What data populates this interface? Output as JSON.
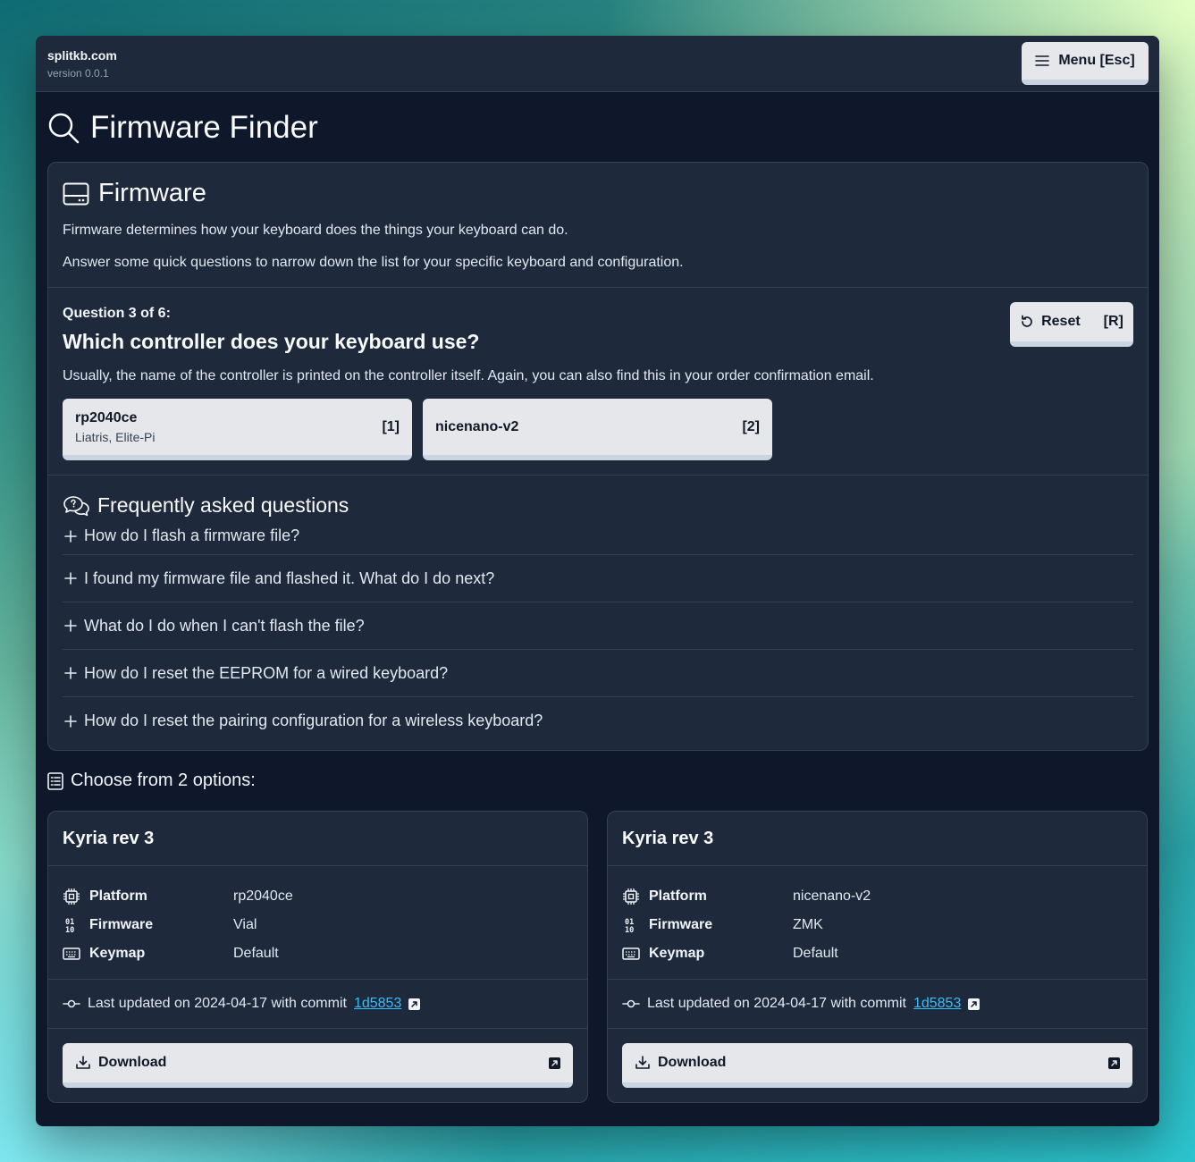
{
  "header": {
    "site": "splitkb.com",
    "version": "version 0.0.1",
    "menu_label": "Menu [Esc]"
  },
  "page": {
    "title": "Firmware Finder"
  },
  "firmware": {
    "title": "Firmware",
    "desc1": "Firmware determines how your keyboard does the things your keyboard can do.",
    "desc2": "Answer some quick questions to narrow down the list for your specific keyboard and configuration."
  },
  "question": {
    "number": "Question 3 of 6:",
    "title": "Which controller does your keyboard use?",
    "desc": "Usually, the name of the controller is printed on the controller itself. Again, you can also find this in your order confirmation email.",
    "reset_label": "Reset",
    "reset_key": "[R]",
    "options": [
      {
        "name": "rp2040ce",
        "sub": "Liatris, Elite-Pi",
        "key": "[1]"
      },
      {
        "name": "nicenano-v2",
        "sub": "",
        "key": "[2]"
      }
    ]
  },
  "faq": {
    "title": "Frequently asked questions",
    "items": [
      "How do I flash a firmware file?",
      "I found my firmware file and flashed it. What do I do next?",
      "What do I do when I can't flash the file?",
      "How do I reset the EEPROM for a wired keyboard?",
      "How do I reset the pairing configuration for a wireless keyboard?"
    ]
  },
  "results": {
    "heading": "Choose from 2 options:",
    "labels": {
      "platform": "Platform",
      "firmware": "Firmware",
      "keymap": "Keymap"
    },
    "cards": [
      {
        "title": "Kyria rev 3",
        "platform": "rp2040ce",
        "firmware": "Vial",
        "keymap": "Default",
        "updated_text": "Last updated on 2024-04-17 with commit",
        "commit": "1d5853",
        "download": "Download"
      },
      {
        "title": "Kyria rev 3",
        "platform": "nicenano-v2",
        "firmware": "ZMK",
        "keymap": "Default",
        "updated_text": "Last updated on 2024-04-17 with commit",
        "commit": "1d5853",
        "download": "Download"
      }
    ]
  },
  "icons": {
    "search": "search-icon",
    "menu": "hamburger-icon",
    "firmware": "hard-drive-icon",
    "reset": "rotate-ccw-icon",
    "faq": "chat-bubbles-icon",
    "plus": "plus-icon",
    "list": "list-icon",
    "cpu": "cpu-icon",
    "binary": "binary-icon",
    "keyboard": "keyboard-icon",
    "commit": "git-commit-icon",
    "download": "download-icon",
    "external": "external-link-icon"
  },
  "colors": {
    "background": "#0f172a",
    "panel": "#1e293b",
    "button": "#e5e7eb",
    "link": "#38bdf8"
  }
}
